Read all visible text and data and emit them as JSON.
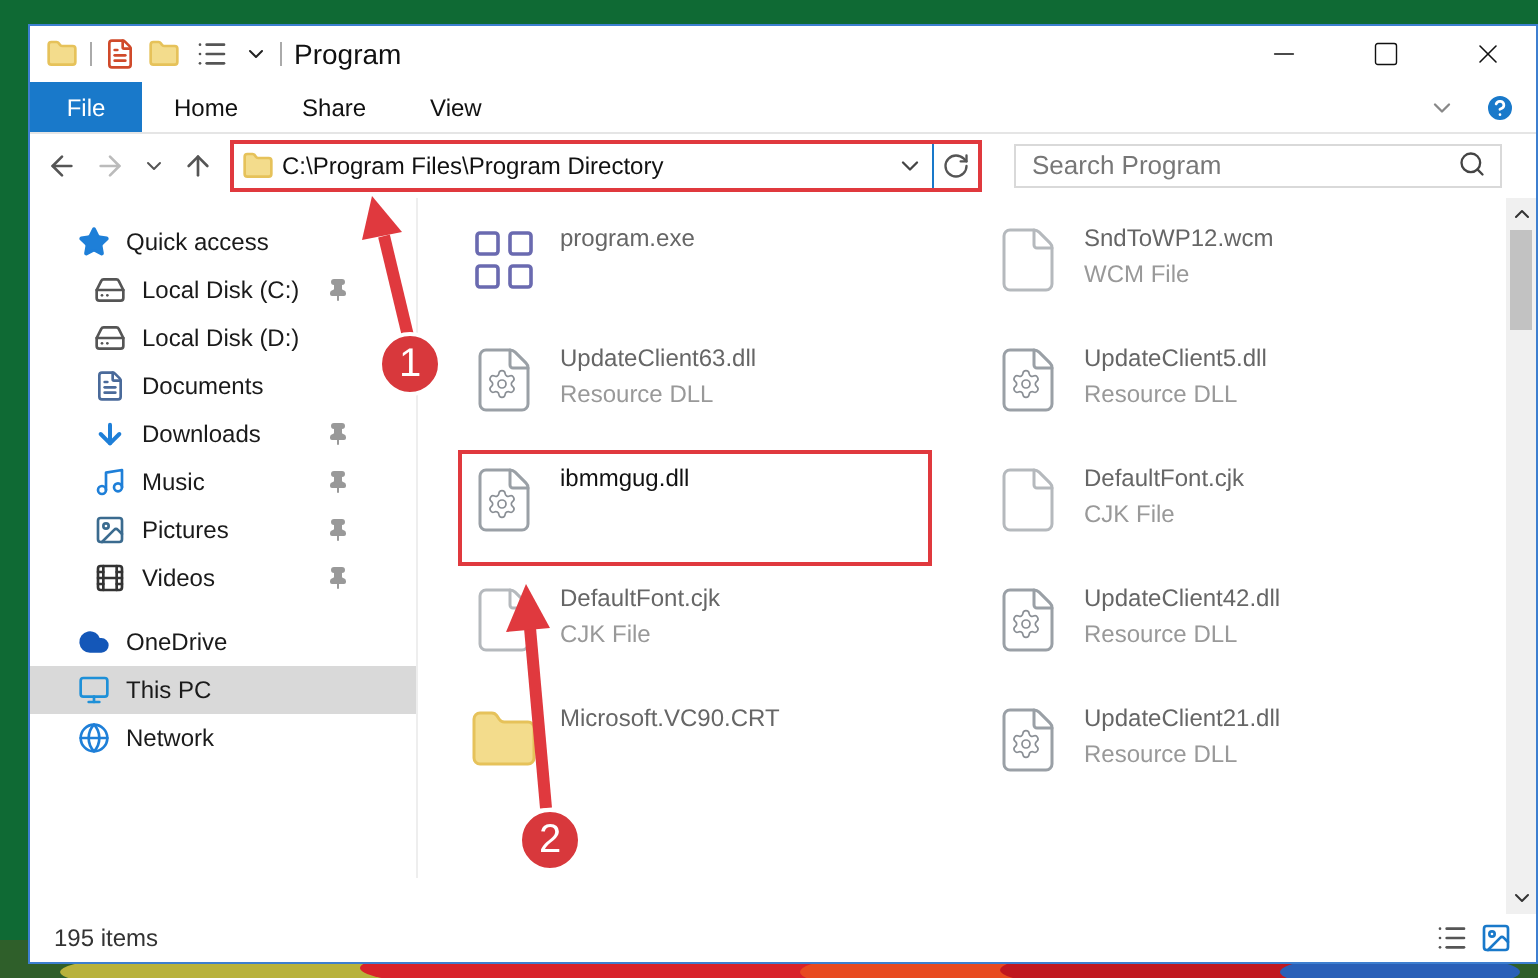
{
  "window": {
    "title": "Program"
  },
  "ribbon": {
    "tabs": [
      {
        "label": "File",
        "selected": true
      },
      {
        "label": "Home",
        "selected": false
      },
      {
        "label": "Share",
        "selected": false
      },
      {
        "label": "View",
        "selected": false
      }
    ]
  },
  "address_bar": {
    "path": "C:\\Program Files\\Program Directory",
    "highlighted": true
  },
  "search": {
    "placeholder": "Search Program"
  },
  "sidebar": {
    "items": [
      {
        "label": "Quick access",
        "kind": "star",
        "pinned": false,
        "selected": false,
        "children": [
          {
            "label": "Local Disk (C:)",
            "kind": "disk",
            "pinned": true,
            "selected": false
          },
          {
            "label": "Local Disk (D:)",
            "kind": "disk",
            "pinned": false,
            "selected": false
          },
          {
            "label": "Documents",
            "kind": "document",
            "pinned": false,
            "selected": false
          },
          {
            "label": "Downloads",
            "kind": "download",
            "pinned": true,
            "selected": false
          },
          {
            "label": "Music",
            "kind": "music",
            "pinned": true,
            "selected": false
          },
          {
            "label": "Pictures",
            "kind": "pictures",
            "pinned": true,
            "selected": false
          },
          {
            "label": "Videos",
            "kind": "videos",
            "pinned": true,
            "selected": false
          }
        ]
      },
      {
        "label": "OneDrive",
        "kind": "cloud",
        "pinned": false,
        "selected": false
      },
      {
        "label": "This PC",
        "kind": "pc",
        "pinned": false,
        "selected": true
      },
      {
        "label": "Network",
        "kind": "network",
        "pinned": false,
        "selected": false
      }
    ]
  },
  "files": [
    {
      "name": "program.exe",
      "kind": "exe",
      "highlighted": false
    },
    {
      "name": "SndToWP12.wcm",
      "type": "WCM File",
      "kind": "file",
      "highlighted": false
    },
    {
      "name": "UpdateClient63.dll",
      "type": "Resource DLL",
      "kind": "dll",
      "highlighted": false
    },
    {
      "name": "UpdateClient5.dll",
      "type": "Resource DLL",
      "kind": "dll",
      "highlighted": false
    },
    {
      "name": "ibmmgug.dll",
      "kind": "dll",
      "highlighted": true
    },
    {
      "name": "DefaultFont.cjk",
      "type": "CJK File",
      "kind": "file",
      "highlighted": false
    },
    {
      "name": "DefaultFont.cjk",
      "type": "CJK File",
      "kind": "file",
      "highlighted": false
    },
    {
      "name": "UpdateClient42.dll",
      "type": "Resource DLL",
      "kind": "dll",
      "highlighted": false
    },
    {
      "name": "Microsoft.VC90.CRT",
      "kind": "folder",
      "highlighted": false
    },
    {
      "name": "UpdateClient21.dll",
      "type": "Resource DLL",
      "kind": "dll",
      "highlighted": false
    }
  ],
  "status_bar": {
    "item_count": "195 items"
  },
  "annotations": [
    {
      "number": "1"
    },
    {
      "number": "2"
    }
  ]
}
